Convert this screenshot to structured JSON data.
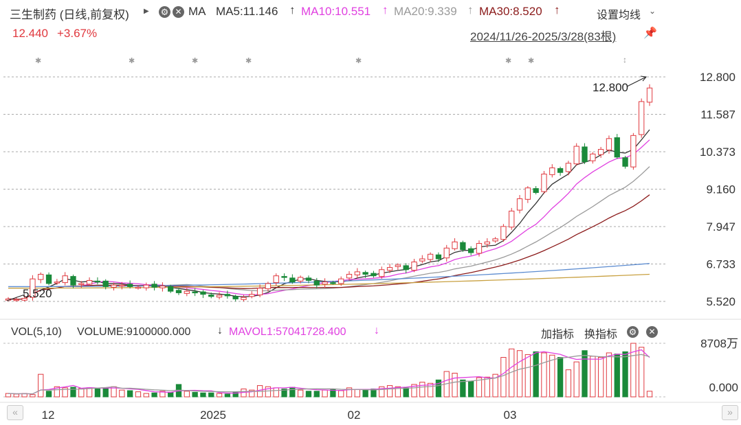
{
  "header": {
    "stock": "三生制药 (日线,前复权)",
    "ma_label": "MA",
    "ma5": "MA5:11.146",
    "ma10": "MA10:10.551",
    "ma20": "MA20:9.339",
    "ma30": "MA30:8.520",
    "settings": "设置均线",
    "price": "12.440",
    "change": "+3.67%",
    "range": "2024/11/26-2025/3/28(83根)"
  },
  "colors": {
    "up": "#e0383e",
    "down": "#1a8a3a",
    "ma5": "#333333",
    "ma10": "#e040e0",
    "ma20": "#9a9a9a",
    "ma30": "#8b1a1a",
    "ma60": "#5b8bd0",
    "ma120": "#c8a040"
  },
  "volume_header": {
    "vol": "VOL(5,10)",
    "volume": "VOLUME:9100000.000",
    "mavol": "MAVOL1:57041728.400",
    "add_indicator": "加指标",
    "switch_indicator": "换指标"
  },
  "chart_data": [
    {
      "type": "candlestick",
      "title": "三生制药 (日线,前复权)",
      "y_ticks": [
        "12.800",
        "11.587",
        "10.373",
        "9.160",
        "7.947",
        "6.733",
        "5.520"
      ],
      "ylim": [
        5.52,
        12.8
      ],
      "x_ticks": [
        "12",
        "2025",
        "02",
        "03"
      ],
      "annotations": {
        "high": "12.800",
        "low": "5.520"
      },
      "close": [
        5.6,
        5.58,
        5.62,
        6.25,
        6.4,
        6.1,
        6.15,
        6.35,
        6.05,
        6.1,
        6.2,
        6.15,
        6.0,
        6.05,
        6.05,
        6.0,
        5.98,
        6.05,
        5.98,
        6.02,
        5.85,
        5.8,
        5.85,
        5.8,
        5.75,
        5.68,
        5.72,
        5.7,
        5.6,
        5.65,
        5.75,
        5.95,
        6.1,
        6.35,
        6.3,
        6.15,
        6.3,
        6.2,
        6.05,
        6.15,
        6.12,
        6.25,
        6.4,
        6.48,
        6.4,
        6.35,
        6.55,
        6.62,
        6.7,
        6.55,
        6.8,
        6.9,
        7.05,
        6.9,
        7.25,
        7.45,
        7.2,
        7.1,
        7.4,
        7.45,
        7.55,
        7.95,
        8.45,
        8.85,
        9.2,
        9.05,
        9.65,
        9.85,
        9.7,
        10.0,
        10.55,
        10.05,
        10.3,
        10.45,
        10.8,
        10.2,
        9.9,
        10.9,
        12.0,
        12.44
      ],
      "ma_levels": {
        "MA5": 11.146,
        "MA10": 10.551,
        "MA20": 9.339,
        "MA30": 8.52
      }
    },
    {
      "type": "bar",
      "title": "VOL(5,10)",
      "y_ticks": [
        "8708万",
        "0.000"
      ],
      "ylim": [
        0,
        87080000
      ],
      "values": [
        6,
        5,
        6,
        4,
        40,
        10,
        18,
        16,
        17,
        15,
        16,
        14,
        16,
        18,
        12,
        11,
        9,
        6,
        7,
        10,
        8,
        22,
        10,
        8,
        7,
        7,
        6,
        5,
        8,
        14,
        12,
        20,
        18,
        16,
        14,
        17,
        12,
        10,
        10,
        12,
        14,
        11,
        16,
        13,
        12,
        14,
        18,
        20,
        18,
        16,
        22,
        26,
        24,
        30,
        45,
        42,
        30,
        28,
        34,
        35,
        40,
        70,
        85,
        82,
        75,
        80,
        78,
        74,
        70,
        48,
        62,
        82,
        72,
        70,
        78,
        76,
        80,
        95,
        88,
        10
      ]
    }
  ]
}
